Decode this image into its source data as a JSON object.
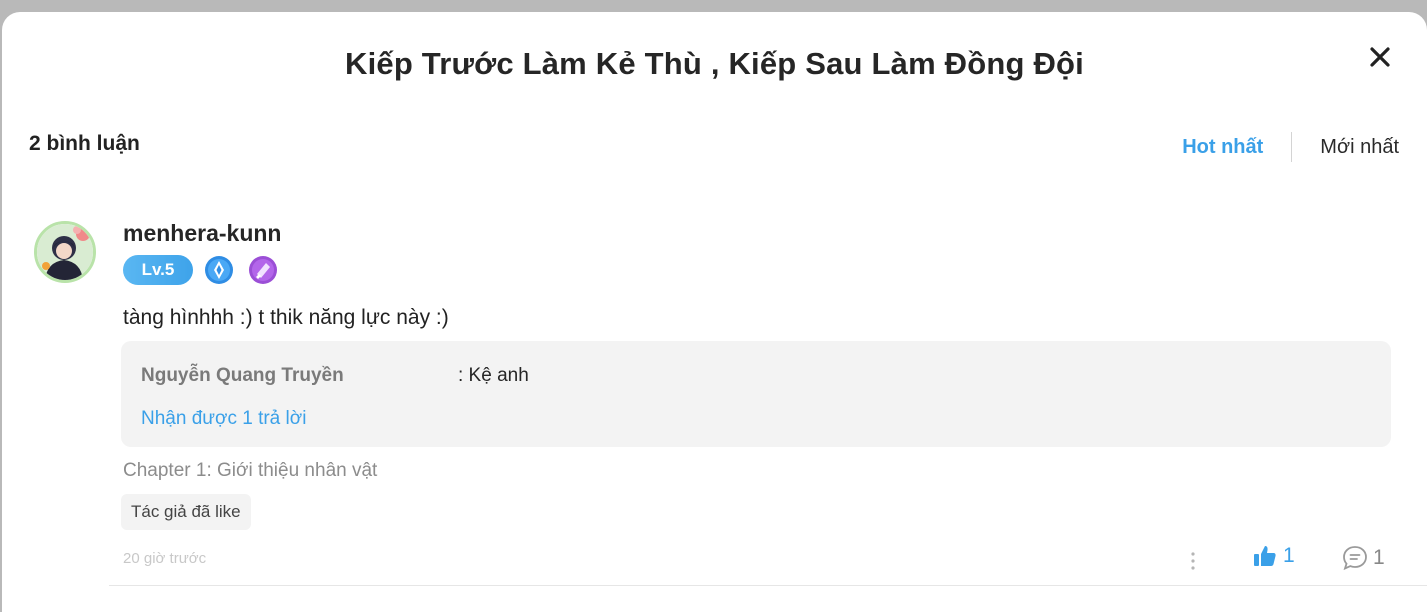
{
  "modal": {
    "title": "Kiếp Trước Làm Kẻ Thù , Kiếp Sau Làm Đồng Đội"
  },
  "comments_header": {
    "count_label": "2 bình luận",
    "sort_hot": "Hot nhất",
    "sort_newest": "Mới nhất"
  },
  "comment": {
    "username": "menhera-kunn",
    "level": "Lv.5",
    "text": "tàng hìnhhh :) t thik năng lực này :)",
    "reply_preview": {
      "author": "Nguyễn Quang Truyền",
      "text": ": Kệ anh",
      "replies_label": "Nhận được 1 trả lời"
    },
    "chapter": "Chapter 1: Giới thiệu nhân vật",
    "author_liked": "Tác giả đã like",
    "timestamp": "20 giờ trước",
    "like_count": "1",
    "reply_count": "1"
  },
  "colors": {
    "accent": "#3aa0e8",
    "badge_blue": "#2f8de4",
    "badge_purple": "#9b4fd6"
  },
  "icons": [
    "close-icon",
    "verified-badge-icon",
    "purple-badge-icon",
    "more-vertical-icon",
    "thumbs-up-icon",
    "comment-icon"
  ]
}
